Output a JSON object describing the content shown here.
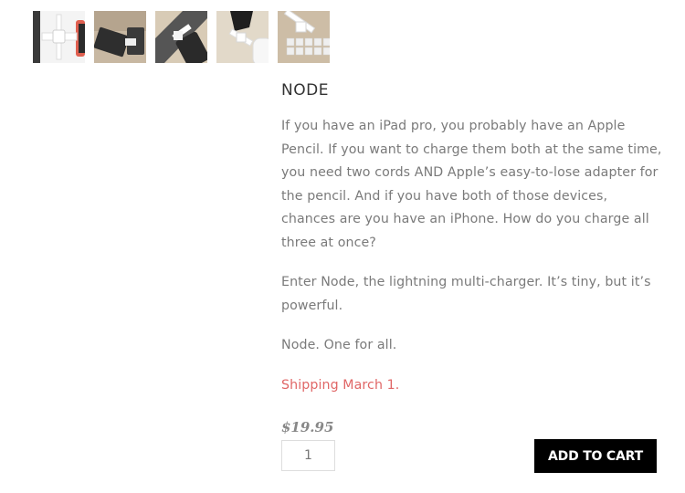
{
  "gallery": {
    "thumbnails": [
      {
        "alt": "node-charger-white-on-grey"
      },
      {
        "alt": "devices-on-wood-desk"
      },
      {
        "alt": "charger-with-phone"
      },
      {
        "alt": "charger-with-earbuds-case"
      },
      {
        "alt": "charger-on-keyboard"
      }
    ]
  },
  "product": {
    "title": "NODE",
    "paragraphs": [
      "If you have an iPad pro, you probably have an Apple Pencil. If you want to charge them both at the same time, you need two cords AND Apple’s easy-to-lose adapter for the pencil. And if you have both of those devices, chances are you have an iPhone. How do you charge all three at once?",
      "Enter Node, the lightning multi-charger. It’s tiny, but it’s powerful.",
      "Node. One for all."
    ],
    "shipping": "Shipping March 1.",
    "price": "$19.95",
    "quantity": "1",
    "add_to_cart_label": "ADD TO CART"
  },
  "colors": {
    "accent_shipping": "#e06666",
    "button_bg": "#000000",
    "button_text": "#ffffff"
  }
}
